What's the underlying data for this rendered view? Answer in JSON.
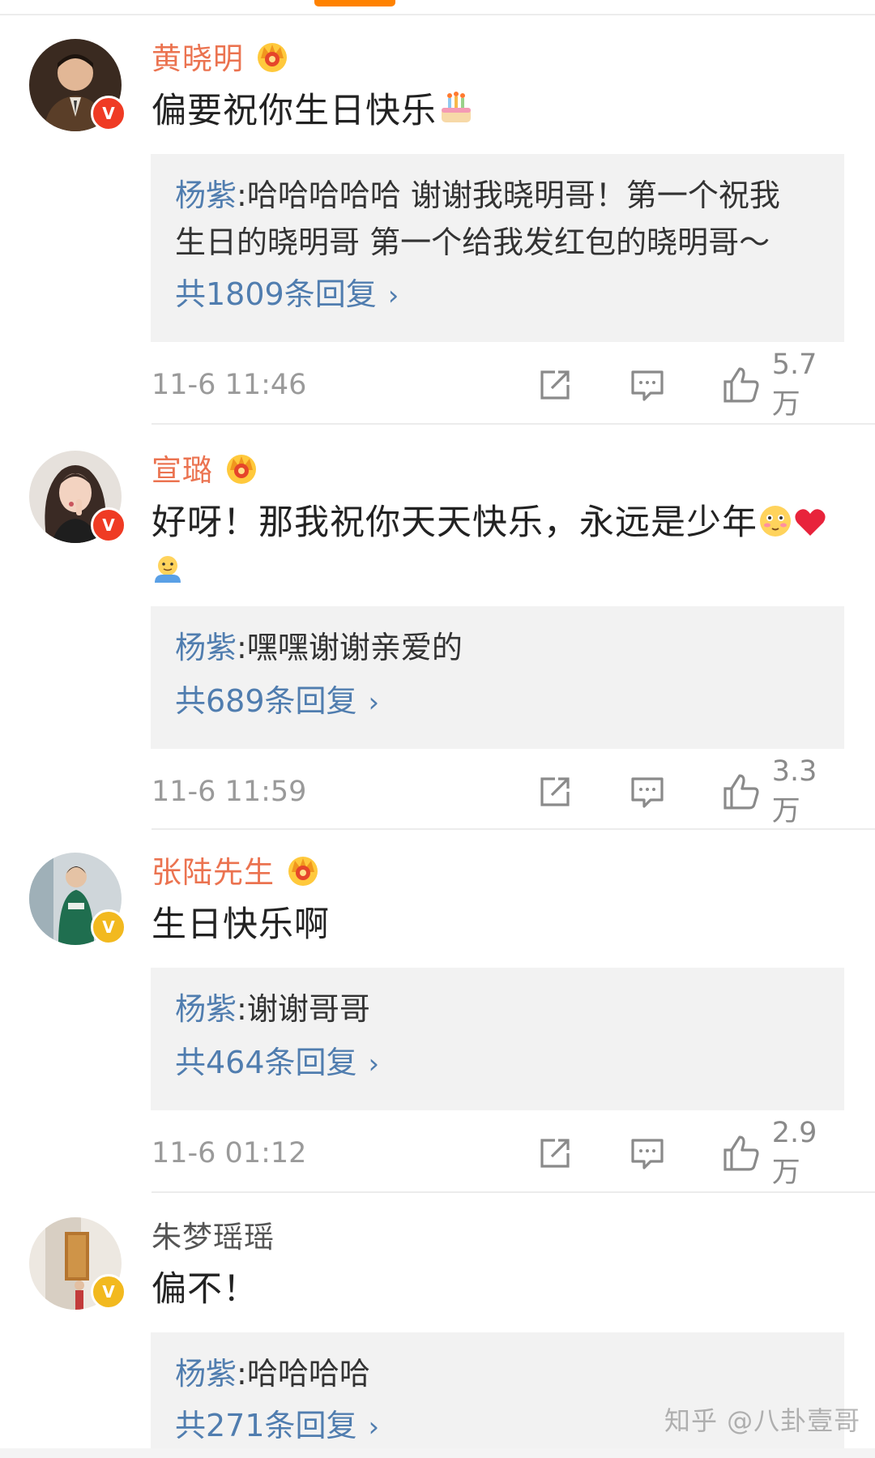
{
  "comments": [
    {
      "username": "黄晓明",
      "text": "偏要祝你生日快乐",
      "emoji_after": "birthday-cake-icon",
      "verified": "V",
      "reply": {
        "author": "杨紫",
        "separator": ":",
        "text": "哈哈哈哈哈 谢谢我晓明哥！第一个祝我生日的晓明哥 第一个给我发红包的晓明哥～",
        "line1": "哈哈哈哈哈 谢谢我晓明哥！第一个祝我",
        "line2": "生日的晓明哥 第一个给我发红包的晓明哥～",
        "count_label": "共1809条回复",
        "chevron": "›"
      },
      "timestamp": "11-6 11:46",
      "likes": "5.7万"
    },
    {
      "username": "宣璐",
      "text": "好呀！那我祝你天天快乐，永远是少年",
      "verified": "V",
      "reply": {
        "author": "杨紫",
        "separator": ":",
        "text": "嘿嘿谢谢亲爱的",
        "count_label": "共689条回复",
        "chevron": "›"
      },
      "timestamp": "11-6 11:59",
      "likes": "3.3万"
    },
    {
      "username": "张陆先生",
      "text": "生日快乐啊",
      "verified": "V",
      "reply": {
        "author": "杨紫",
        "separator": ":",
        "text": "谢谢哥哥",
        "count_label": "共464条回复",
        "chevron": "›"
      },
      "timestamp": "11-6 01:12",
      "likes": "2.9万"
    },
    {
      "username": "朱梦瑶瑶",
      "text": "偏不！",
      "verified": "V",
      "reply": {
        "author": "杨紫",
        "separator": ":",
        "text": "哈哈哈哈",
        "count_label": "共271条回复",
        "chevron": "›"
      }
    }
  ],
  "watermark": "知乎 @八卦壹哥",
  "colors": {
    "vip_name": "#eb7350",
    "link": "#507daf",
    "tab_indicator": "#ff8200",
    "verified_red": "#ef3b24",
    "verified_gold": "#f2b91f"
  },
  "icons": [
    "crown-icon",
    "share-icon",
    "comment-icon",
    "like-icon",
    "birthday-cake-icon",
    "blush-face-icon",
    "heart-icon",
    "hug-icon"
  ]
}
